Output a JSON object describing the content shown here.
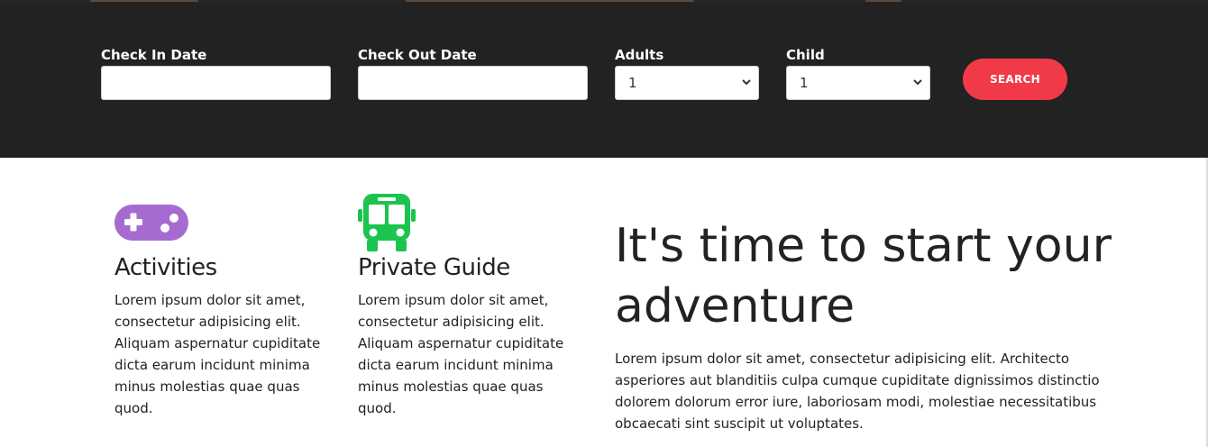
{
  "booking": {
    "check_in_label": "Check In Date",
    "check_in_value": "",
    "check_out_label": "Check Out Date",
    "check_out_value": "",
    "adults_label": "Adults",
    "adults_value": "1",
    "child_label": "Child",
    "child_value": "1",
    "search_label": "SEARCH",
    "accent_color": "#f13a48",
    "background_color": "#222222"
  },
  "features": [
    {
      "icon": "gamepad-icon",
      "icon_color": "#a66bd0",
      "title": "Activities",
      "text": "Lorem ipsum dolor sit amet, consectetur adipisicing elit. Aliquam aspernatur cupiditate dicta earum incidunt minima minus molestias quae quas quod."
    },
    {
      "icon": "bus-icon",
      "icon_color": "#1bc44e",
      "title": "Private Guide",
      "text": "Lorem ipsum dolor sit amet, consectetur adipisicing elit. Aliquam aspernatur cupiditate dicta earum incidunt minima minus molestias quae quas quod."
    }
  ],
  "adventure": {
    "heading": "It's time to start your adventure",
    "text": "Lorem ipsum dolor sit amet, consectetur adipisicing elit. Architecto asperiores aut blanditiis culpa cumque cupiditate dignissimos distinctio dolorem dolorum error iure, laboriosam modi, molestiae necessitatibus obcaecati sint suscipit ut voluptates."
  }
}
